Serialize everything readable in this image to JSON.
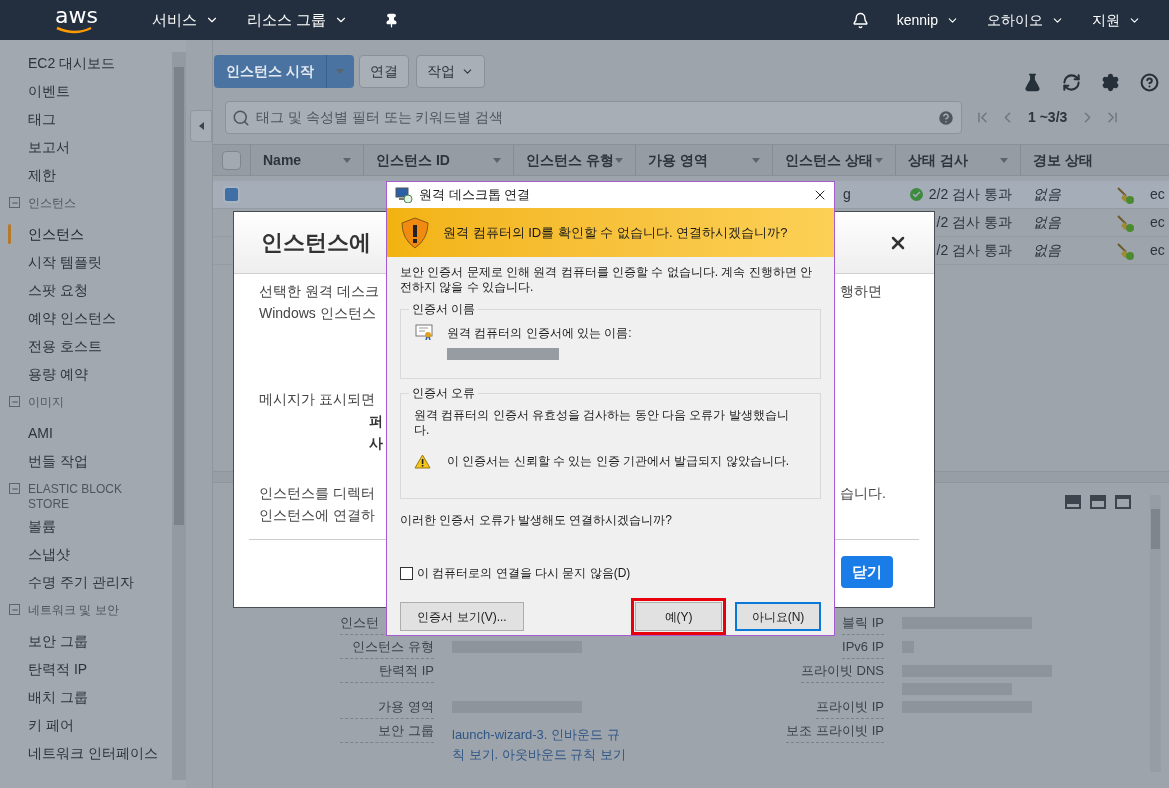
{
  "top_nav": {
    "logo": "aws",
    "menus": [
      {
        "label": "서비스",
        "dropdown": true
      },
      {
        "label": "리소스 그룹",
        "dropdown": true
      }
    ],
    "account_menus": [
      {
        "label": "kennip",
        "dropdown": true
      },
      {
        "label": "오하이오",
        "dropdown": true
      },
      {
        "label": "지원",
        "dropdown": true
      }
    ]
  },
  "sidebar": {
    "items": [
      {
        "label": "EC2 대시보드",
        "selected": false
      },
      {
        "label": "이벤트",
        "selected": false
      },
      {
        "label": "태그",
        "selected": false
      },
      {
        "label": "보고서",
        "selected": false
      },
      {
        "label": "제한",
        "selected": false
      }
    ],
    "sections": [
      {
        "title": "인스턴스",
        "expanded": true,
        "children": [
          {
            "label": "인스턴스",
            "selected": true
          },
          {
            "label": "시작 템플릿",
            "selected": false
          },
          {
            "label": "스팟 요청",
            "selected": false
          },
          {
            "label": "예약 인스턴스",
            "selected": false
          },
          {
            "label": "전용 호스트",
            "selected": false
          },
          {
            "label": "용량 예약",
            "selected": false
          }
        ]
      },
      {
        "title": "이미지",
        "expanded": true,
        "children": [
          {
            "label": "AMI",
            "selected": false
          },
          {
            "label": "번들 작업",
            "selected": false
          }
        ]
      },
      {
        "title": "ELASTIC BLOCK STORE",
        "expanded": true,
        "children": [
          {
            "label": "볼륨",
            "selected": false
          },
          {
            "label": "스냅샷",
            "selected": false
          },
          {
            "label": "수명 주기 관리자",
            "selected": false
          }
        ]
      },
      {
        "title": "네트워크 및 보안",
        "expanded": true,
        "children": [
          {
            "label": "보안 그룹",
            "selected": false
          },
          {
            "label": "탄력적 IP",
            "selected": false
          },
          {
            "label": "배치 그룹",
            "selected": false
          },
          {
            "label": "키 페어",
            "selected": false
          },
          {
            "label": "네트워크 인터페이스",
            "selected": false
          }
        ]
      }
    ]
  },
  "toolbar": {
    "buttons": [
      {
        "label": "인스턴스 시작",
        "kind": "split"
      },
      {
        "label": "연결",
        "kind": "plain"
      },
      {
        "label": "작업",
        "kind": "dropdown"
      }
    ]
  },
  "search": {
    "placeholder": "태그 및 속성별 필터 또는 키워드별 검색",
    "pagination": "1 ~3/3"
  },
  "table": {
    "select_all": {
      "checked": false
    },
    "columns": [
      {
        "label": "Name",
        "sortable": true
      },
      {
        "label": "인스턴스 ID",
        "sortable": true
      },
      {
        "label": "인스턴스 유형",
        "sortable": true
      },
      {
        "label": "가용 영역",
        "sortable": true
      },
      {
        "label": "인스턴스 상태",
        "sortable": true
      },
      {
        "label": "상태 검사",
        "sortable": true
      },
      {
        "label": "경보 상태",
        "sortable": false
      }
    ],
    "rows": [
      {
        "selected": true,
        "instance_state": "g",
        "status_check": "2/2 검사 통과",
        "status_ok": true,
        "alarm_status": "없음",
        "column_9": "ec"
      },
      {
        "selected": false,
        "status_check": "/2 검사 통과",
        "alarm_status": "없음",
        "column_9": "ec"
      },
      {
        "selected": false,
        "status_check": "/2 검사 통과",
        "alarm_status": "없음",
        "column_9": "ec"
      }
    ]
  },
  "details": {
    "rows": [
      {
        "left": {
          "label": "인스턴",
          "kind": "cut"
        },
        "right": {
          "label": "블릭 IP",
          "value": {
            "kind": "redacted"
          }
        }
      },
      {
        "left": {
          "label": "인스턴스 유형",
          "value": {
            "kind": "redacted"
          }
        },
        "right": {
          "label": "IPv6 IP",
          "value": {
            "kind": "redacted_short"
          }
        }
      },
      {
        "left": {
          "label": "탄력적 IP"
        },
        "right": {
          "label": "프라이빗 DNS",
          "value": {
            "kind": "redacted_multiline"
          }
        }
      },
      {
        "left": {
          "label": "가용 영역",
          "value": {
            "kind": "redacted"
          }
        },
        "right": {
          "label": "프라이빗 IP",
          "value": {
            "kind": "redacted"
          }
        }
      },
      {
        "left": {
          "label": "보안 그룹",
          "value": {
            "kind": "link",
            "text": "launch-wizard-3. 인바운드 규칙 보기. 아웃바운드 규칙 보기"
          }
        },
        "right": {
          "label": "보조 프라이빗 IP"
        }
      }
    ]
  },
  "connect_modal": {
    "title": "인스턴스에",
    "paragraphs": [
      [
        {
          "left": "선택한 원격 데스크",
          "right": "행하면"
        },
        {
          "left": "Windows 인스턴스"
        }
      ],
      [
        {
          "left": "메시지가 표시되면"
        },
        {
          "left": "퍼",
          "kind": "bold"
        },
        {
          "left": "사",
          "kind": "bold"
        }
      ],
      [
        {
          "left": "인스턴스를 디렉터",
          "right": "습니다."
        },
        {
          "left": "인스턴스에 연결하"
        }
      ]
    ],
    "close_button": "닫기"
  },
  "rdp_dialog": {
    "title": "원격 데스크톱 연결",
    "warning": "원격 컴퓨터의 ID를 확인할 수 없습니다. 연결하시겠습니까?",
    "message": "보안 인증서 문제로 인해 원격 컴퓨터를 인증할 수 없습니다. 계속 진행하면 안전하지 않을 수 있습니다.",
    "cert_name": {
      "title": "인증서 이름",
      "label": "원격 컴퓨터의 인증서에 있는 이름:"
    },
    "cert_errors": {
      "title": "인증서 오류",
      "text": "원격 컴퓨터의 인증서 유효성을 검사하는 동안 다음 오류가 발생했습니다.",
      "errors": [
        "이 인증서는 신뢰할 수 있는 인증 기관에서 발급되지 않았습니다."
      ]
    },
    "question": "이러한 인증서 오류가 발생해도 연결하시겠습니까?",
    "dont_ask": {
      "label": "이 컴퓨터로의 연결을 다시 묻지 않음(D)",
      "checked": false
    },
    "buttons": [
      {
        "label": "인증서 보기(V)...",
        "kind": "view",
        "highlighted": false,
        "default": false
      },
      {
        "label": "예(Y)",
        "kind": "yes",
        "highlighted": true,
        "default": false
      },
      {
        "label": "아니요(N)",
        "kind": "no",
        "highlighted": false,
        "default": true
      }
    ]
  }
}
